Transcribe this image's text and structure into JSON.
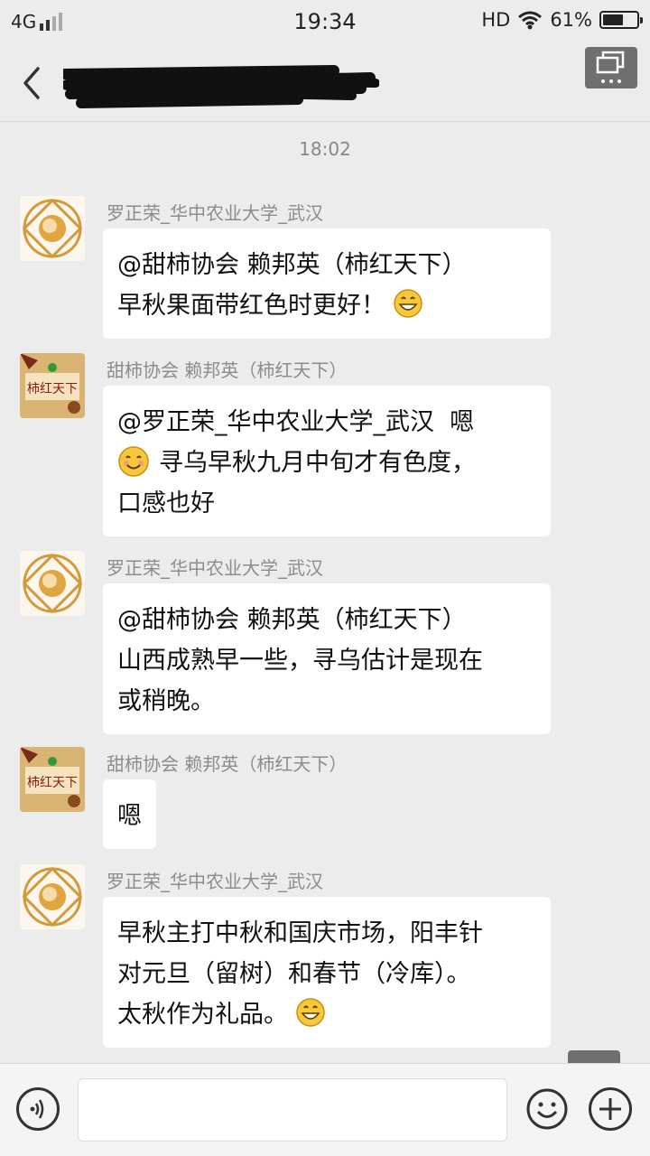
{
  "status_bar": {
    "network": "4G",
    "time": "19:34",
    "hd": "HD",
    "battery": "61%",
    "battery_level": 0.61
  },
  "header": {
    "title": ""
  },
  "chat": {
    "timestamp": "18:02",
    "messages": [
      {
        "sender": "罗正荣_华中农业大学_武汉",
        "avatar": "university-seal-avatar",
        "text": "@甜柿协会 赖邦英（柿红天下）\n早秋果面带红色时更好！",
        "emoji": "grin-emoji"
      },
      {
        "sender": "甜柿协会 赖邦英（柿红天下）",
        "avatar": "persimmon-brand-avatar",
        "avatar_text": "柿红天下",
        "text_before": "@罗正荣_华中农业大学_武汉  嗯\n",
        "text": "寻乌早秋九月中旬才有色度，\n口感也好",
        "emoji": "smile-emoji"
      },
      {
        "sender": "罗正荣_华中农业大学_武汉",
        "avatar": "university-seal-avatar",
        "text": "@甜柿协会 赖邦英（柿红天下）\n山西成熟早一些，寻乌估计是现在\n或稍晚。"
      },
      {
        "sender": "甜柿协会 赖邦英（柿红天下）",
        "avatar": "persimmon-brand-avatar",
        "avatar_text": "柿红天下",
        "text": "嗯"
      },
      {
        "sender": "罗正荣_华中农业大学_武汉",
        "avatar": "university-seal-avatar",
        "text": "早秋主打中秋和国庆市场，阳丰针\n对元旦（留树）和春节（冷库）。\n太秋作为礼品。",
        "emoji": "grin-emoji"
      }
    ]
  },
  "input_bar": {
    "placeholder": ""
  }
}
